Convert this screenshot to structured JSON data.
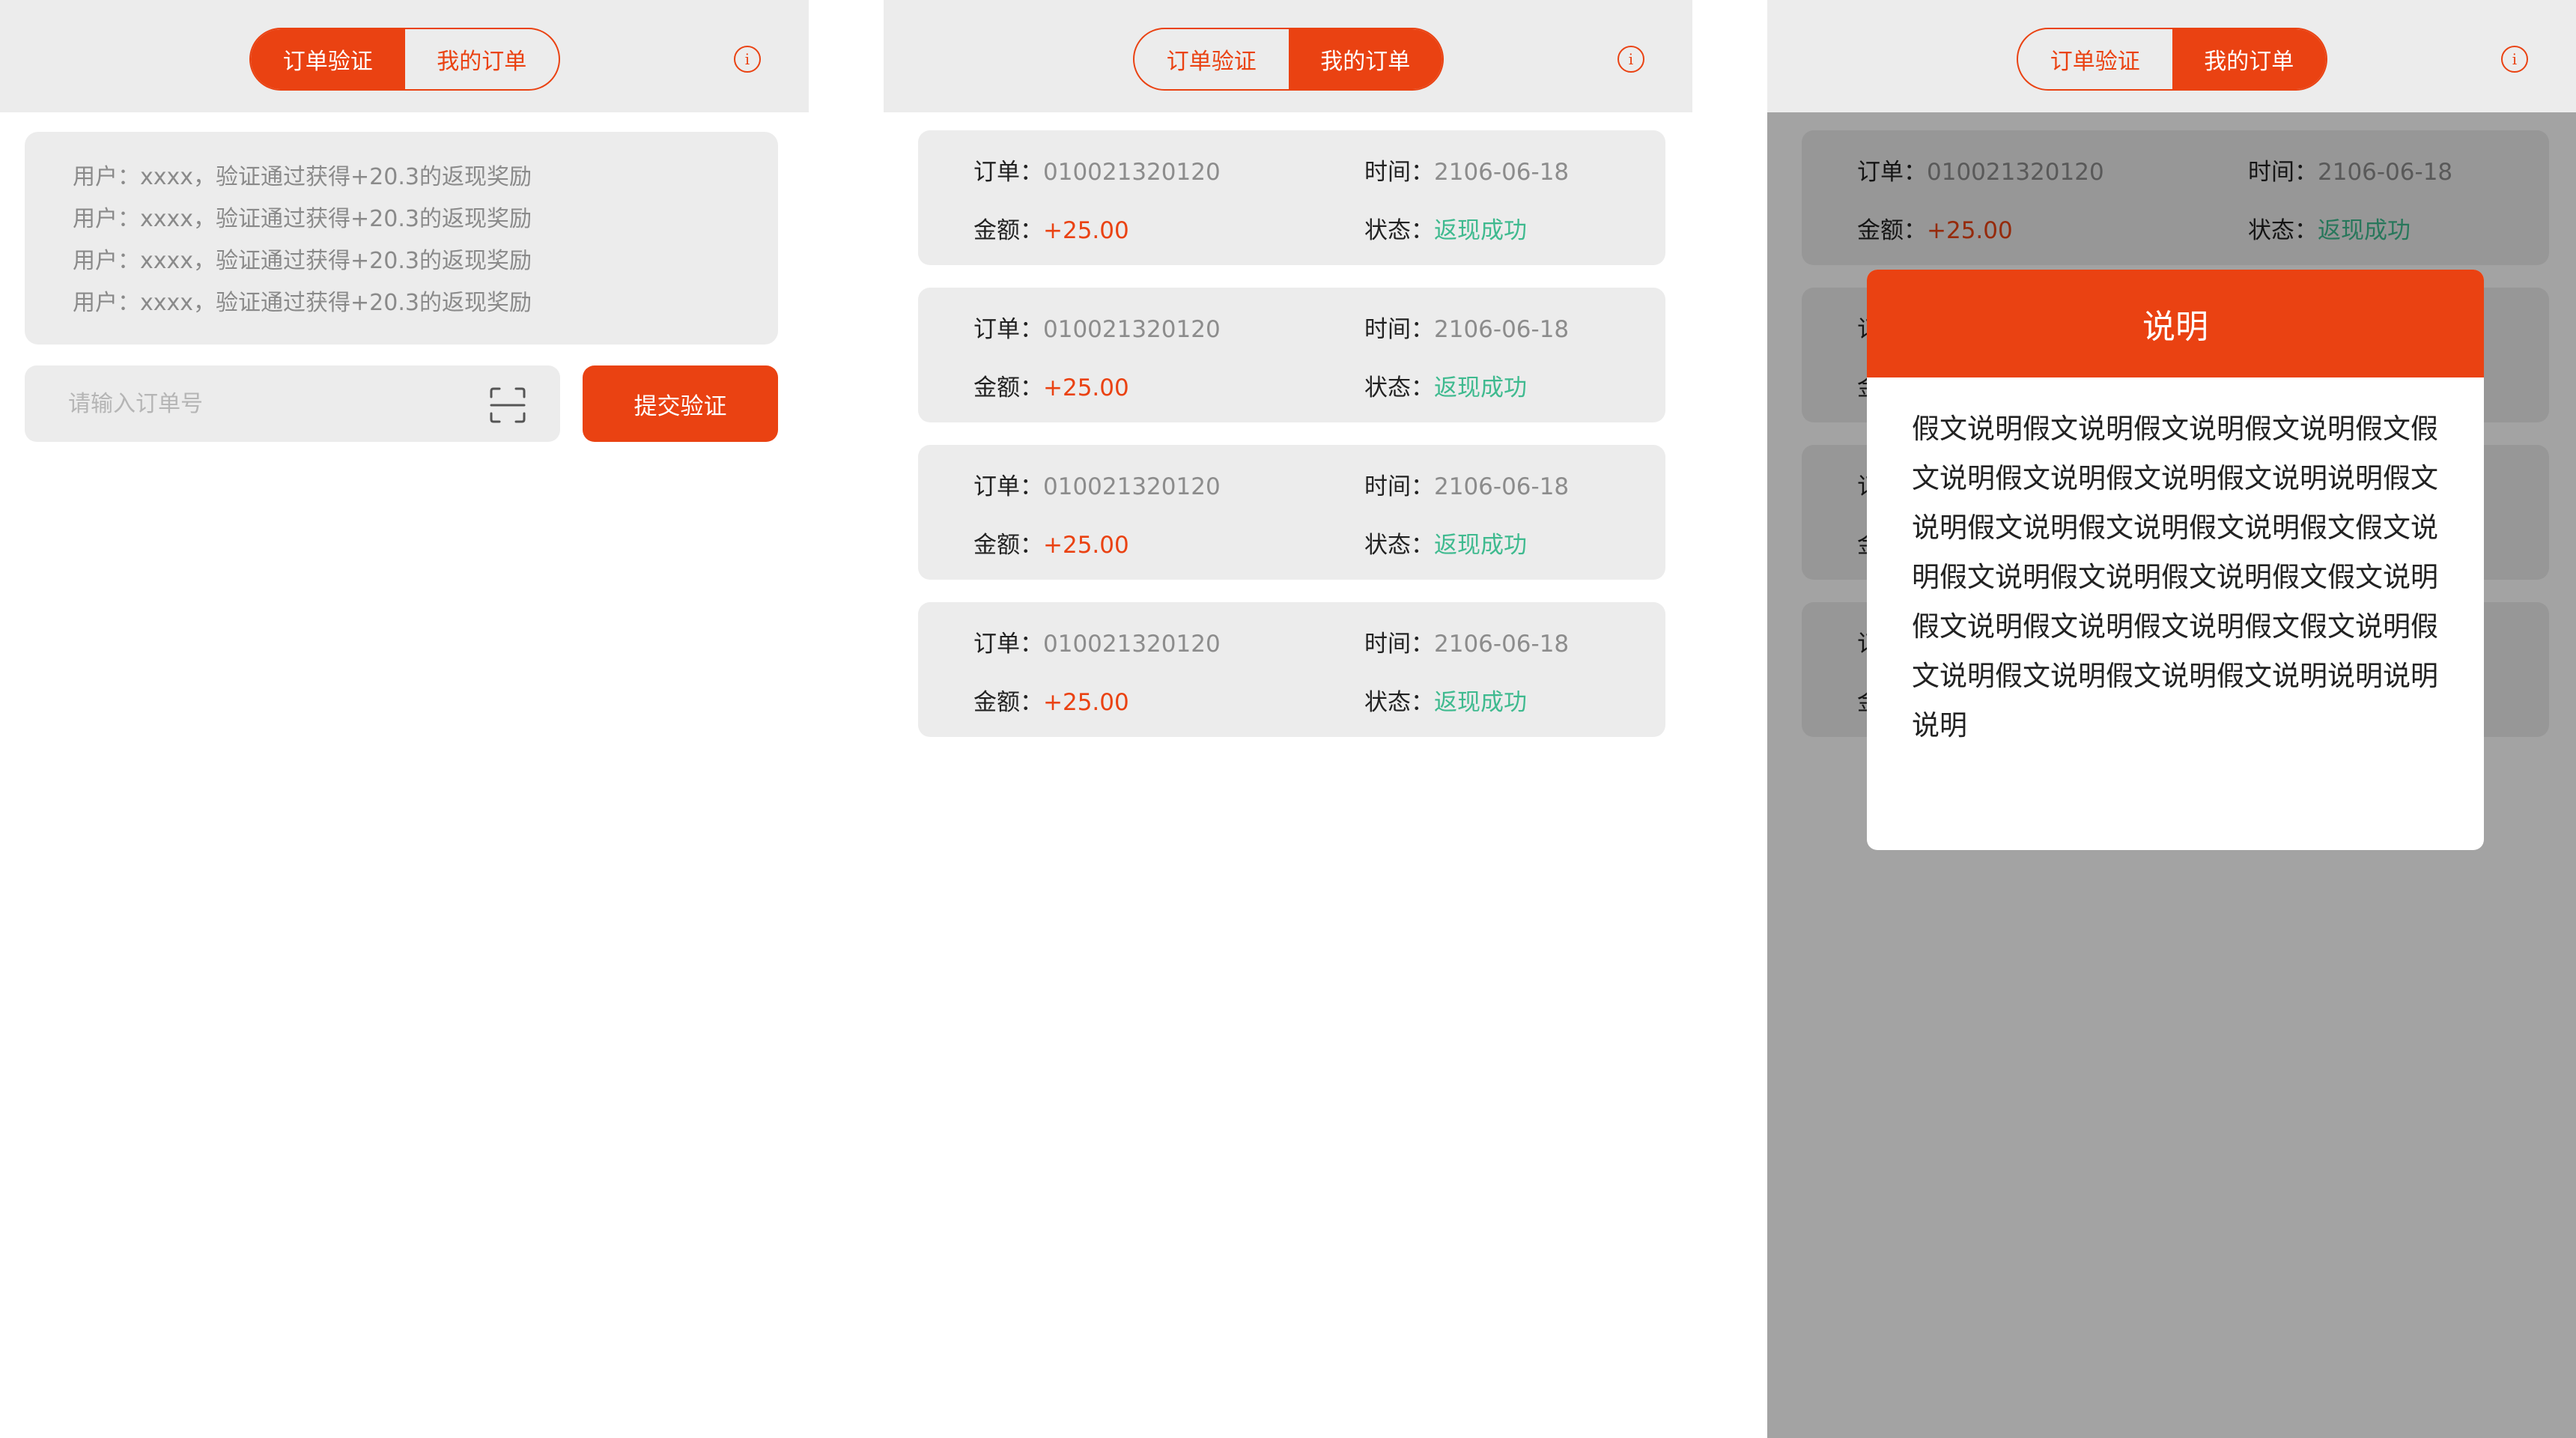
{
  "colors": {
    "accent": "#ea4212",
    "success": "#3fba8f",
    "muted": "#8c8c8c",
    "header_bg": "#ececec"
  },
  "tabs": {
    "verify": "订单验证",
    "my_orders": "我的订单"
  },
  "info_icon": {
    "name": "info-icon",
    "glyph": "i"
  },
  "verify_screen": {
    "notices": [
      "用户：xxxx，验证通过获得+20.3的返现奖励",
      "用户：xxxx，验证通过获得+20.3的返现奖励",
      "用户：xxxx，验证通过获得+20.3的返现奖励",
      "用户：xxxx，验证通过获得+20.3的返现奖励"
    ],
    "input_placeholder": "请输入订单号",
    "scan_icon": "scan-icon",
    "submit_label": "提交验证"
  },
  "orders_screen": {
    "labels": {
      "order": "订单：",
      "time": "时间：",
      "amount": "金额：",
      "status": "状态："
    },
    "orders": [
      {
        "order_no": "010021320120",
        "time": "2106-06-18",
        "amount": "+25.00",
        "status": "返现成功"
      },
      {
        "order_no": "010021320120",
        "time": "2106-06-18",
        "amount": "+25.00",
        "status": "返现成功"
      },
      {
        "order_no": "010021320120",
        "time": "2106-06-18",
        "amount": "+25.00",
        "status": "返现成功"
      },
      {
        "order_no": "010021320120",
        "time": "2106-06-18",
        "amount": "+25.00",
        "status": "返现成功"
      }
    ]
  },
  "dialog": {
    "title": "说明",
    "body": "假文说明假文说明假文说明假文说明假文假文说明假文说明假文说明假文说明说明假文说明假文说明假文说明假文说明假文假文说明假文说明假文说明假文说明假文假文说明假文说明假文说明假文说明假文假文说明假文说明假文说明假文说明假文说明说明说明说明"
  }
}
